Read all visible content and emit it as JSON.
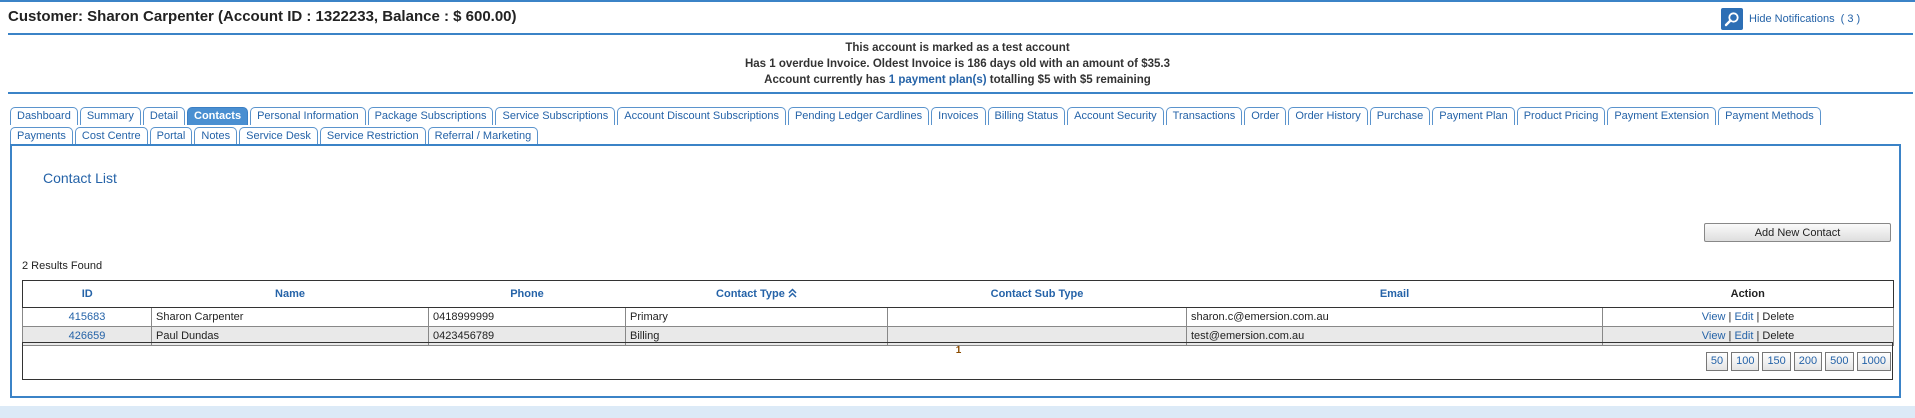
{
  "header": {
    "title": "Customer: Sharon Carpenter (Account ID : 1322233, Balance : $ 600.00)",
    "notification_icon": "search-icon",
    "hide_notifications_label": "Hide Notifications",
    "notification_count": "( 3 )"
  },
  "alerts": {
    "line1": "This account is marked as a test account",
    "line2": "Has 1 overdue Invoice. Oldest Invoice is 186 days old with an amount of $35.3",
    "line3_prefix": "Account currently has ",
    "line3_link": "1 payment plan(s)",
    "line3_suffix": " totalling $5 with $5 remaining"
  },
  "tabs": [
    "Dashboard",
    "Summary",
    "Detail",
    "Contacts",
    "Personal Information",
    "Package Subscriptions",
    "Service Subscriptions",
    "Account Discount Subscriptions",
    "Pending Ledger Cardlines",
    "Invoices",
    "Billing Status",
    "Account Security",
    "Transactions",
    "Order",
    "Order History",
    "Purchase",
    "Payment Plan",
    "Product Pricing",
    "Payment Extension",
    "Payment Methods",
    "Payments",
    "Cost Centre",
    "Portal",
    "Notes",
    "Service Desk",
    "Service Restriction",
    "Referral / Marketing"
  ],
  "active_tab": "Contacts",
  "contacts": {
    "title": "Contact List",
    "add_button_label": "Add New Contact",
    "results_text": "2 Results Found",
    "columns": [
      "ID",
      "Name",
      "Phone",
      "Contact Type",
      "Contact Sub Type",
      "Email",
      "Action"
    ],
    "sort_icon": "sort-ascending-icon",
    "rows": [
      {
        "id": "415683",
        "name": "Sharon Carpenter",
        "phone": "0418999999",
        "type": "Primary",
        "subtype": "",
        "email": "sharon.c@emersion.com.au"
      },
      {
        "id": "426659",
        "name": "Paul Dundas",
        "phone": "0423456789",
        "type": "Billing",
        "subtype": "",
        "email": "test@emersion.com.au"
      }
    ],
    "actions": {
      "view": "View",
      "edit": "Edit",
      "delete": "Delete",
      "separator": "|"
    },
    "current_page": "1",
    "page_sizes": [
      "50",
      "100",
      "150",
      "200",
      "500",
      "1000"
    ]
  },
  "colors": {
    "accent": "#3b83c7",
    "link": "#2563a8",
    "active_tab": "#4a8fd1"
  }
}
